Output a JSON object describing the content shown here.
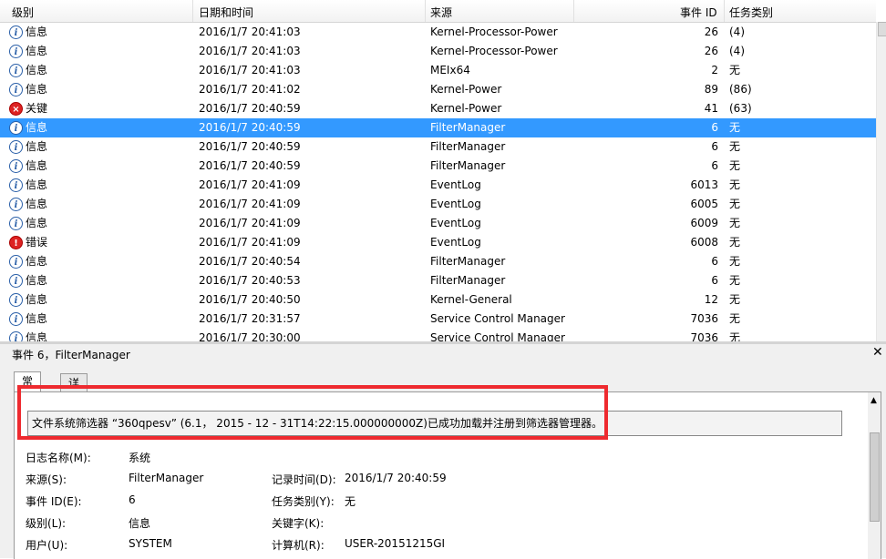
{
  "columns": {
    "level": "级别",
    "datetime": "日期和时间",
    "source": "来源",
    "event_id": "事件 ID",
    "task": "任务类别"
  },
  "rows": [
    {
      "level": "信息",
      "type": "info",
      "dt": "2016/1/7 20:41:03",
      "source": "Kernel-Processor-Power",
      "id": "26",
      "task": "(4)",
      "selected": false
    },
    {
      "level": "信息",
      "type": "info",
      "dt": "2016/1/7 20:41:03",
      "source": "Kernel-Processor-Power",
      "id": "26",
      "task": "(4)",
      "selected": false
    },
    {
      "level": "信息",
      "type": "info",
      "dt": "2016/1/7 20:41:03",
      "source": "MEIx64",
      "id": "2",
      "task": "无",
      "selected": false
    },
    {
      "level": "信息",
      "type": "info",
      "dt": "2016/1/7 20:41:02",
      "source": "Kernel-Power",
      "id": "89",
      "task": "(86)",
      "selected": false
    },
    {
      "level": "关键",
      "type": "crit",
      "dt": "2016/1/7 20:40:59",
      "source": "Kernel-Power",
      "id": "41",
      "task": "(63)",
      "selected": false
    },
    {
      "level": "信息",
      "type": "info",
      "dt": "2016/1/7 20:40:59",
      "source": "FilterManager",
      "id": "6",
      "task": "无",
      "selected": true
    },
    {
      "level": "信息",
      "type": "info",
      "dt": "2016/1/7 20:40:59",
      "source": "FilterManager",
      "id": "6",
      "task": "无",
      "selected": false
    },
    {
      "level": "信息",
      "type": "info",
      "dt": "2016/1/7 20:40:59",
      "source": "FilterManager",
      "id": "6",
      "task": "无",
      "selected": false
    },
    {
      "level": "信息",
      "type": "info",
      "dt": "2016/1/7 20:41:09",
      "source": "EventLog",
      "id": "6013",
      "task": "无",
      "selected": false
    },
    {
      "level": "信息",
      "type": "info",
      "dt": "2016/1/7 20:41:09",
      "source": "EventLog",
      "id": "6005",
      "task": "无",
      "selected": false
    },
    {
      "level": "信息",
      "type": "info",
      "dt": "2016/1/7 20:41:09",
      "source": "EventLog",
      "id": "6009",
      "task": "无",
      "selected": false
    },
    {
      "level": "错误",
      "type": "err",
      "dt": "2016/1/7 20:41:09",
      "source": "EventLog",
      "id": "6008",
      "task": "无",
      "selected": false
    },
    {
      "level": "信息",
      "type": "info",
      "dt": "2016/1/7 20:40:54",
      "source": "FilterManager",
      "id": "6",
      "task": "无",
      "selected": false
    },
    {
      "level": "信息",
      "type": "info",
      "dt": "2016/1/7 20:40:53",
      "source": "FilterManager",
      "id": "6",
      "task": "无",
      "selected": false
    },
    {
      "level": "信息",
      "type": "info",
      "dt": "2016/1/7 20:40:50",
      "source": "Kernel-General",
      "id": "12",
      "task": "无",
      "selected": false
    },
    {
      "level": "信息",
      "type": "info",
      "dt": "2016/1/7 20:31:57",
      "source": "Service Control Manager",
      "id": "7036",
      "task": "无",
      "selected": false
    },
    {
      "level": "信息",
      "type": "info",
      "dt": "2016/1/7 20:30:00",
      "source": "Service Control Manager",
      "id": "7036",
      "task": "无",
      "selected": false
    }
  ],
  "detail": {
    "title": "事件 6，FilterManager",
    "close": "✕",
    "tabs": [
      "常规",
      "详细信息"
    ],
    "message": "文件系统筛选器 “360qpesv” (6.1，  2015  -  12  -  31T14:22:15.000000000Z)已成功加载并注册到筛选器管理器。",
    "fields": {
      "log_name_label": "日志名称(M):",
      "log_name": "系统",
      "source_label": "来源(S):",
      "source": "FilterManager",
      "record_time_label": "记录时间(D):",
      "record_time": "2016/1/7 20:40:59",
      "event_id_label": "事件 ID(E):",
      "event_id": "6",
      "task_label": "任务类别(Y):",
      "task": "无",
      "level_label": "级别(L):",
      "level": "信息",
      "keywords_label": "关键字(K):",
      "keywords": "",
      "user_label": "用户(U):",
      "user": "SYSTEM",
      "computer_label": "计算机(R):",
      "computer": "USER-20151215GI"
    }
  },
  "icons": {
    "info": "info-icon",
    "crit": "critical-icon",
    "err": "error-icon"
  }
}
